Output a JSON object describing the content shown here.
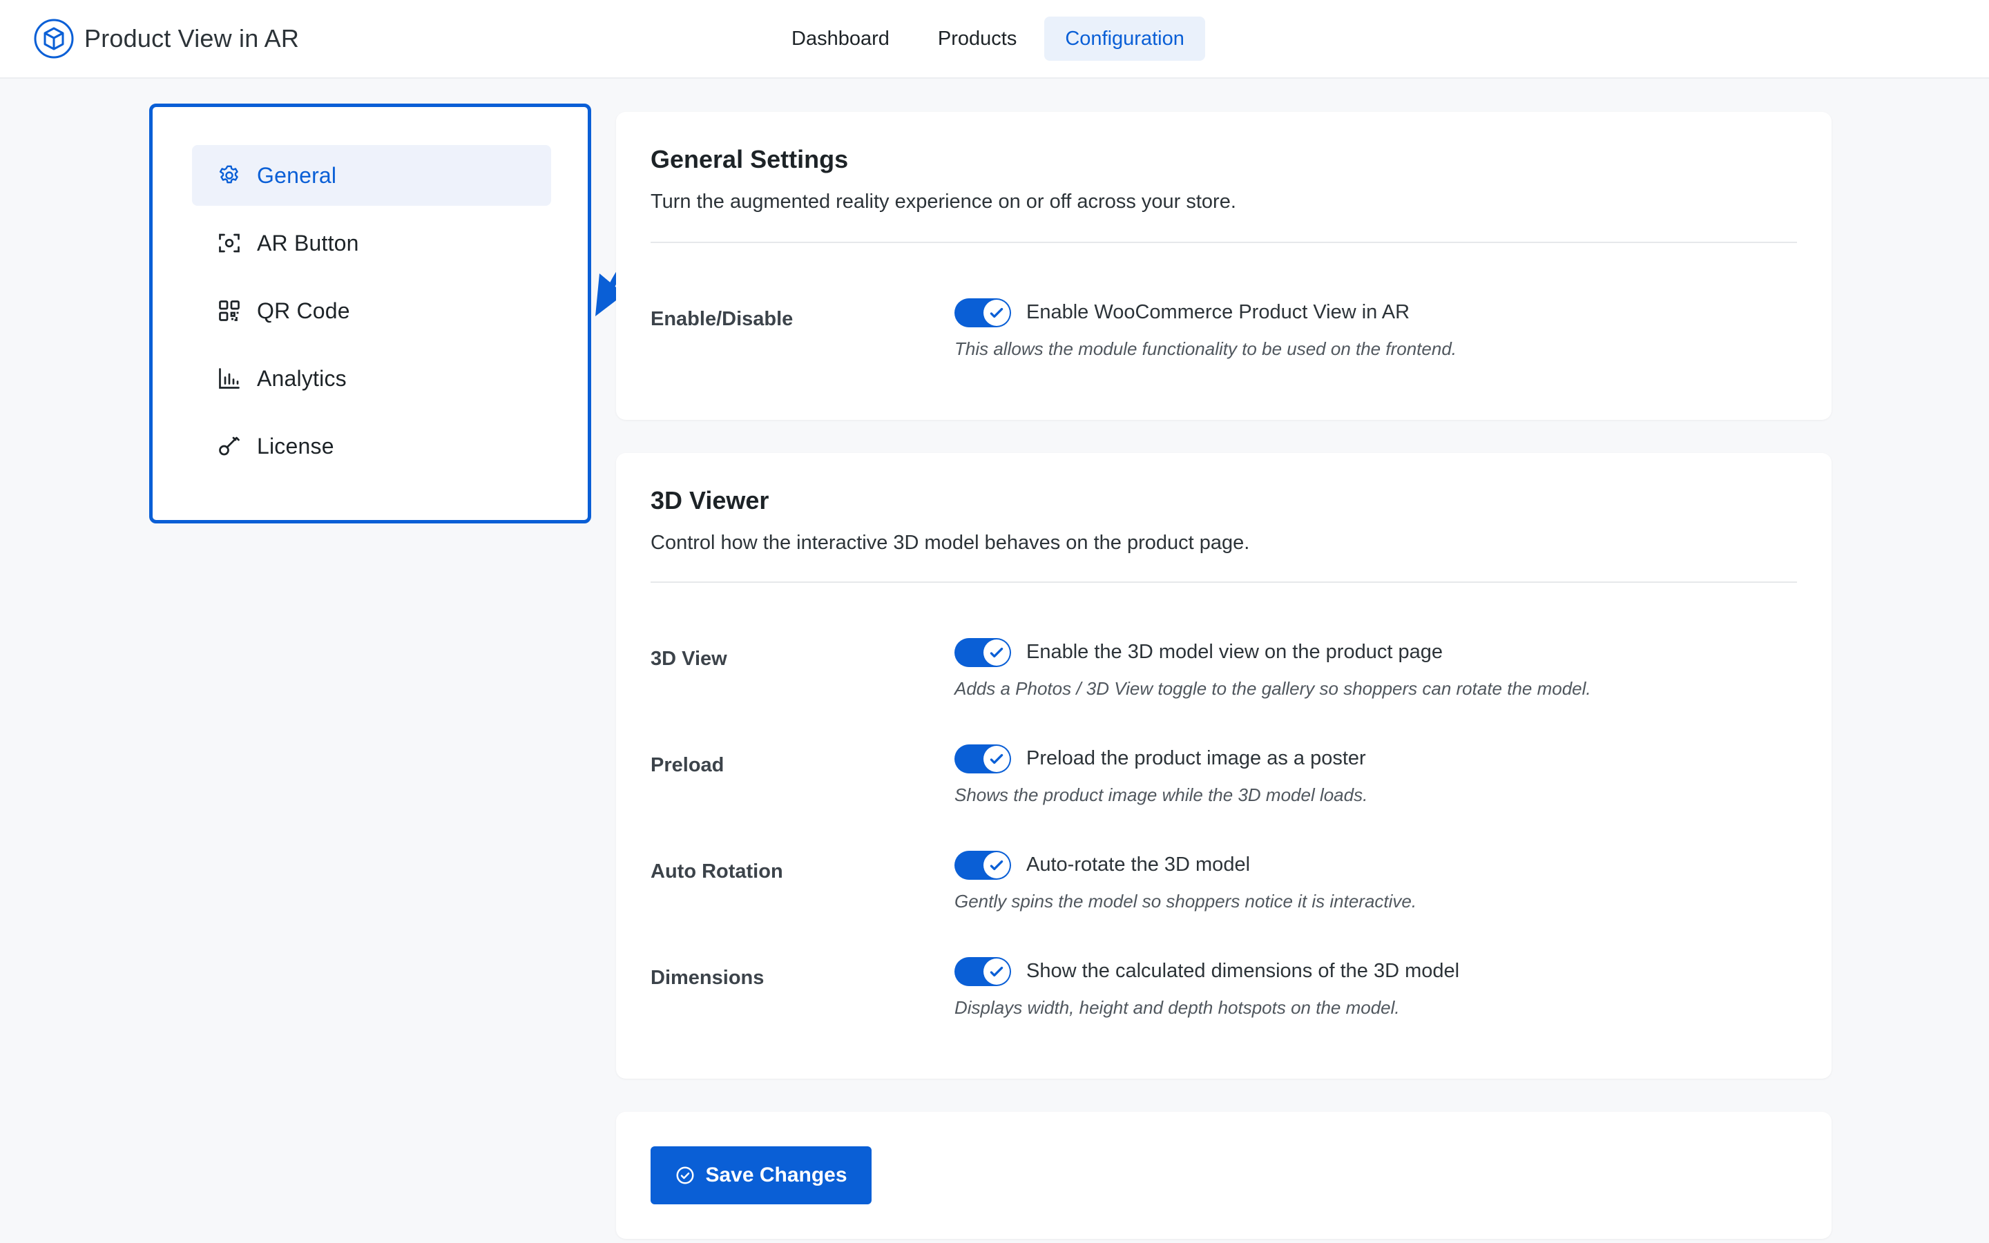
{
  "app": {
    "title": "Product View in AR",
    "logo_icon": "cube-icon"
  },
  "nav": {
    "tabs": [
      {
        "label": "Dashboard",
        "active": false
      },
      {
        "label": "Products",
        "active": false
      },
      {
        "label": "Configuration",
        "active": true
      }
    ]
  },
  "sidebar": {
    "items": [
      {
        "label": "General",
        "icon": "gear-icon",
        "active": true
      },
      {
        "label": "AR Button",
        "icon": "scan-icon",
        "active": false
      },
      {
        "label": "QR Code",
        "icon": "qr-code-icon",
        "active": false
      },
      {
        "label": "Analytics",
        "icon": "bar-chart-icon",
        "active": false
      },
      {
        "label": "License",
        "icon": "key-icon",
        "active": false
      }
    ]
  },
  "general": {
    "title": "General Settings",
    "description": "Turn the augmented reality experience on or off across your store.",
    "rows": [
      {
        "label": "Enable/Disable",
        "enabled": true,
        "option": "Enable WooCommerce Product View in AR",
        "help": "This allows the module functionality to be used on the frontend."
      }
    ]
  },
  "viewer": {
    "title": "3D Viewer",
    "description": "Control how the interactive 3D model behaves on the product page.",
    "rows": [
      {
        "label": "3D View",
        "enabled": true,
        "option": "Enable the 3D model view on the product page",
        "help": "Adds a Photos / 3D View toggle to the gallery so shoppers can rotate the model."
      },
      {
        "label": "Preload",
        "enabled": true,
        "option": "Preload the product image as a poster",
        "help": "Shows the product image while the 3D model loads."
      },
      {
        "label": "Auto Rotation",
        "enabled": true,
        "option": "Auto-rotate the 3D model",
        "help": "Gently spins the model so shoppers notice it is interactive."
      },
      {
        "label": "Dimensions",
        "enabled": true,
        "option": "Show the calculated dimensions of the 3D model",
        "help": "Displays width, height and depth hotspots on the model."
      }
    ]
  },
  "actions": {
    "save_label": "Save Changes",
    "save_icon": "check-circle-icon"
  },
  "colors": {
    "accent": "#0a5fd6",
    "accent_soft": "#eaf1fb",
    "background": "#f7f8fa"
  }
}
